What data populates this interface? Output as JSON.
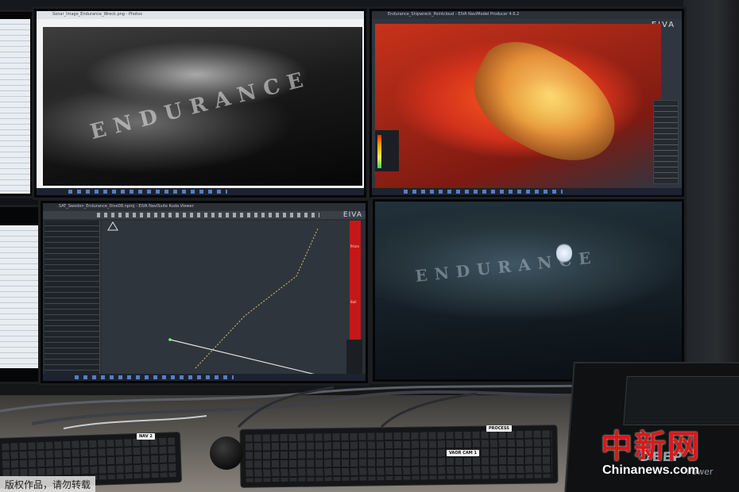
{
  "monitors": {
    "top_left": {
      "window_title": "Sonar_Image_Endurance_Wreck.png - Photos",
      "hull_text": "ENDURANCE"
    },
    "top_right": {
      "window_title": "Endurance_Shipwreck_Pointcloud - EIVA NaviModel Producer 4.6.2",
      "brand": "EIVA"
    },
    "bottom_left": {
      "window_title": "SAT_Sweden_Endurance_Dive08.nproj - EIVA NaviSuite Kuda Viewer",
      "brand": "EIVA",
      "depth_label_top": "Prism",
      "depth_label_bottom": "Bull"
    },
    "bottom_right": {
      "hull_text": "ENDURANCE"
    }
  },
  "keyboard_labels": {
    "left": "NAV 2",
    "process": "PROCESS",
    "vaor": "VAOR CAM 1"
  },
  "device": {
    "logo": "DEEP",
    "subtext": "Power"
  },
  "watermark": {
    "chinese": "中新网",
    "english": "Chinanews.com",
    "copyright": "版权作品，请勿转载"
  },
  "colors": {
    "watermark_red": "#d81919",
    "depth_bar": "#c41818",
    "pointcloud_hot": "#ff5a1f"
  }
}
